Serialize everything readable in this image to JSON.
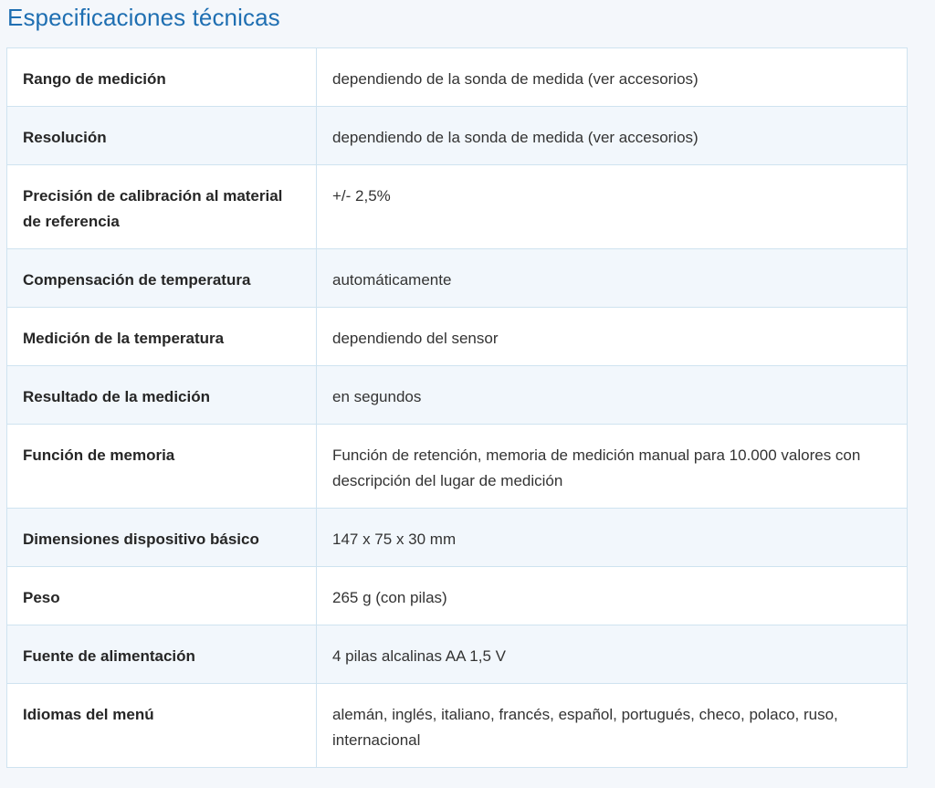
{
  "title": "Especificaciones técnicas",
  "specs": [
    {
      "label": "Rango de medición",
      "value": "dependiendo de la sonda de medida (ver accesorios)"
    },
    {
      "label": "Resolución",
      "value": "dependiendo de la sonda de medida (ver accesorios)"
    },
    {
      "label": "Precisión de calibración al material de referencia",
      "value": "+/- 2,5%"
    },
    {
      "label": "Compensación de temperatura",
      "value": "automáticamente"
    },
    {
      "label": "Medición de la temperatura",
      "value": "dependiendo del sensor"
    },
    {
      "label": "Resultado de la medición",
      "value": "en segundos"
    },
    {
      "label": "Función de memoria",
      "value": "Función de retención, memoria de medición manual para 10.000 valores con descripción del lugar de medición"
    },
    {
      "label": "Dimensiones dispositivo básico",
      "value": "147 x 75 x 30 mm"
    },
    {
      "label": "Peso",
      "value": "265 g (con pilas)"
    },
    {
      "label": "Fuente de alimentación",
      "value": "4 pilas alcalinas AA 1,5 V"
    },
    {
      "label": "Idiomas del menú",
      "value": "alemán, inglés, italiano, francés, español, portugués, checo, polaco, ruso, internacional"
    }
  ]
}
